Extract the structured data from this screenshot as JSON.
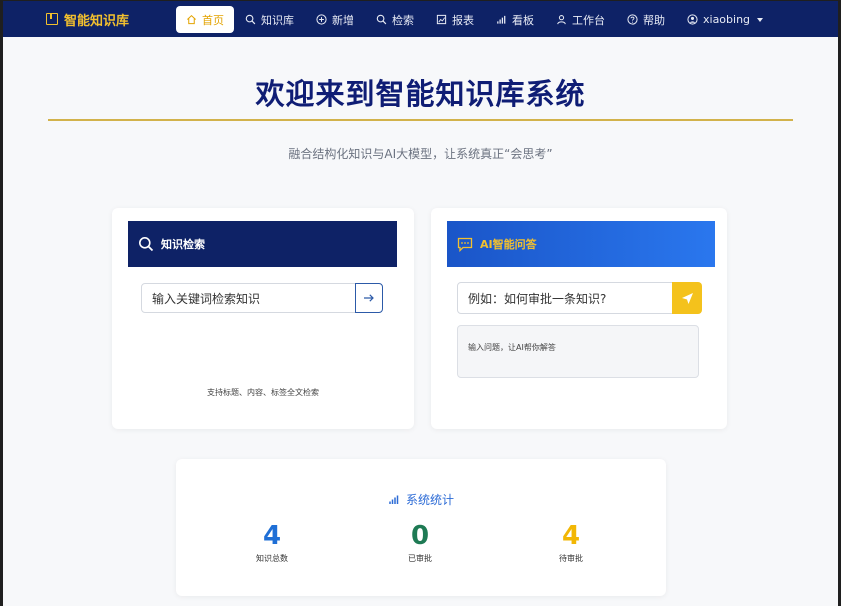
{
  "brand": {
    "name": "智能知识库"
  },
  "nav": {
    "items": [
      {
        "label": "首页",
        "icon": "home-icon"
      },
      {
        "label": "知识库",
        "icon": "search-icon"
      },
      {
        "label": "新增",
        "icon": "plus-circle-icon"
      },
      {
        "label": "检索",
        "icon": "search-icon"
      },
      {
        "label": "报表",
        "icon": "report-icon"
      },
      {
        "label": "看板",
        "icon": "bar-chart-icon"
      },
      {
        "label": "工作台",
        "icon": "user-icon"
      },
      {
        "label": "帮助",
        "icon": "help-icon"
      }
    ],
    "user": "xiaobing"
  },
  "hero": {
    "title": "欢迎来到智能知识库系统",
    "subtitle": "融合结构化知识与AI大模型，让系统真正“会思考”"
  },
  "search_card": {
    "title": "知识检索",
    "placeholder": "输入关键词检索知识",
    "hint": "支持标题、内容、标签全文检索"
  },
  "ai_card": {
    "title": "AI智能问答",
    "placeholder": "例如：如何审批一条知识?",
    "answer_placeholder": "输入问题，让AI帮你解答"
  },
  "stats": {
    "title": "系统统计",
    "items": [
      {
        "value": "4",
        "label": "知识总数",
        "color": "#1f6fd6"
      },
      {
        "value": "0",
        "label": "已审批",
        "color": "#1e7a54"
      },
      {
        "value": "4",
        "label": "待审批",
        "color": "#f2b705"
      }
    ]
  },
  "colors": {
    "navbar": "#0e2266",
    "accent": "#f2c02e",
    "title": "#0f1d75",
    "ai_gradient_start": "#1a55c8"
  }
}
